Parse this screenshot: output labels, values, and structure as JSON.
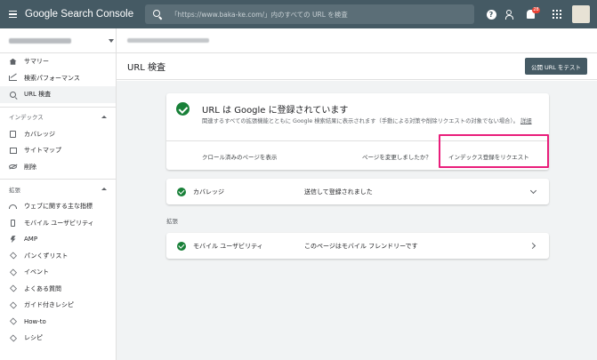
{
  "app": {
    "title": "Google Search Console"
  },
  "search": {
    "placeholder": "「https://www.baka-ke.com/」内のすべての URL を検査"
  },
  "topbar": {
    "help_icon": "?",
    "notifications_badge": "28"
  },
  "sidebar": {
    "items": [
      {
        "label": "サマリー",
        "icon": "home-icon"
      },
      {
        "label": "検索パフォーマンス",
        "icon": "trend-icon"
      },
      {
        "label": "URL 検査",
        "icon": "search-icon",
        "active": true
      }
    ],
    "index_section": "インデックス",
    "index_items": [
      {
        "label": "カバレッジ",
        "icon": "doc-icon"
      },
      {
        "label": "サイトマップ",
        "icon": "sitemap-icon"
      },
      {
        "label": "削除",
        "icon": "removal-icon"
      }
    ],
    "enhancements_section": "拡張",
    "enhancement_items": [
      {
        "label": "ウェブに関する主な指標",
        "icon": "gauge-icon"
      },
      {
        "label": "モバイル ユーザビリティ",
        "icon": "phone-icon"
      },
      {
        "label": "AMP",
        "icon": "bolt-icon"
      },
      {
        "label": "パンくずリスト",
        "icon": "layers-icon"
      },
      {
        "label": "イベント",
        "icon": "layers-icon"
      },
      {
        "label": "よくある質問",
        "icon": "layers-icon"
      },
      {
        "label": "ガイド付きレシピ",
        "icon": "layers-icon"
      },
      {
        "label": "How-to",
        "icon": "layers-icon"
      },
      {
        "label": "レシピ",
        "icon": "layers-icon"
      }
    ]
  },
  "main": {
    "page_title": "URL 検査",
    "test_button": "公開 URL をテスト",
    "status_card": {
      "title": "URL は Google に登録されています",
      "description": "関連するすべての拡張機能とともに Google 検索結果に表示されます（手動による対策や削除リクエストの対象でない場合）。",
      "details_link": "詳細",
      "crawled_page": "クロール済みのページを表示",
      "question": "ページを変更しましたか？",
      "request_indexing": "インデックス登録をリクエスト"
    },
    "coverage": {
      "label": "カバレッジ",
      "value": "送信して登録されました"
    },
    "enhancements_label": "拡張",
    "mobile": {
      "label": "モバイル ユーザビリティ",
      "value": "このページはモバイル フレンドリーです"
    }
  },
  "colors": {
    "topbar": "#455a64",
    "success": "#188038",
    "highlight": "#e91e7b"
  }
}
